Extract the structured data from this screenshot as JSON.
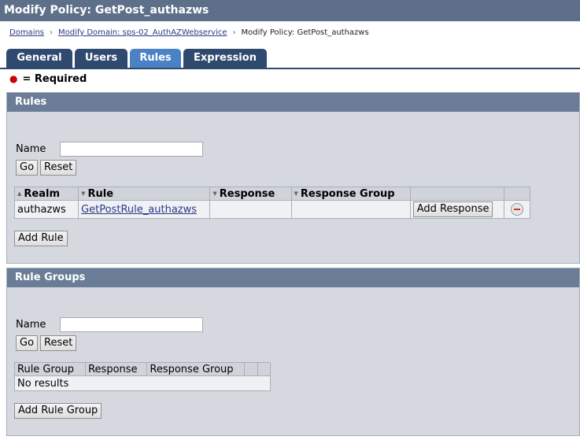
{
  "title": "Modify Policy: GetPost_authazws",
  "breadcrumb": {
    "items": [
      {
        "label": "Domains"
      },
      {
        "label": "Modify Domain: sps-02_AuthAZWebservice"
      },
      {
        "label": "Modify Policy: GetPost_authazws"
      }
    ],
    "separator": "›"
  },
  "tabs": [
    {
      "label": "General"
    },
    {
      "label": "Users"
    },
    {
      "label": "Rules"
    },
    {
      "label": "Expression"
    }
  ],
  "active_tab": "Rules",
  "required_note": "= Required",
  "rules": {
    "title": "Rules",
    "name_label": "Name",
    "name_value": "",
    "go_label": "Go",
    "reset_label": "Reset",
    "columns": [
      "Realm",
      "Rule",
      "Response",
      "Response Group"
    ],
    "rows": [
      {
        "realm": "authazws",
        "rule": "GetPostRule_authazws",
        "response": "",
        "response_group": "",
        "action_label": "Add Response"
      }
    ],
    "add_label": "Add Rule"
  },
  "rule_groups": {
    "title": "Rule Groups",
    "name_label": "Name",
    "name_value": "",
    "go_label": "Go",
    "reset_label": "Reset",
    "columns": [
      "Rule Group",
      "Response",
      "Response Group"
    ],
    "empty_text": "No results",
    "add_label": "Add Rule Group"
  },
  "colors": {
    "title_bar": "#5e7089",
    "tab": "#2f4a6e",
    "tab_active": "#4b82c6",
    "panel_header": "#6a7c96",
    "panel_body": "#d5d9df",
    "link": "#2a3a86",
    "required_dot": "#cc0000"
  }
}
